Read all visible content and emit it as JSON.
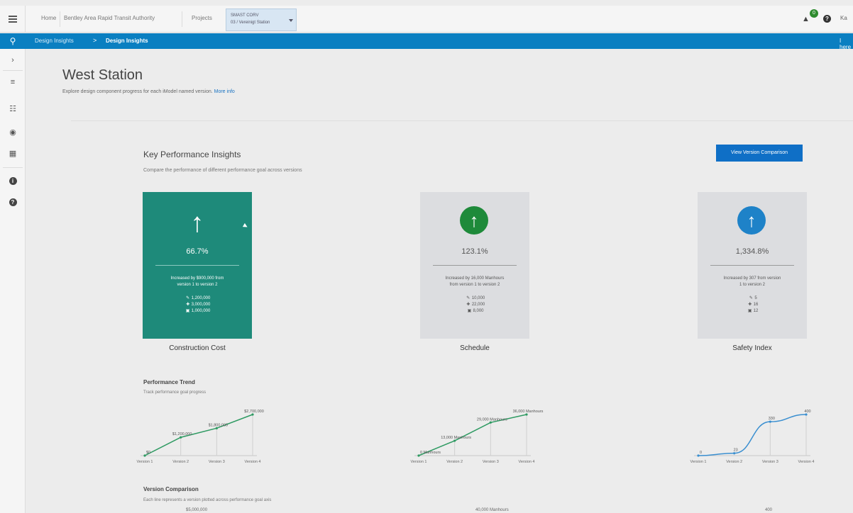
{
  "header": {
    "nav": [
      "Home",
      "Bentley Area Rapid Transit Authority",
      "Projects"
    ],
    "project_line1": "SMAST CORV",
    "project_line2": "03 / Vereinigt Station",
    "notifications": "0",
    "help_icon": "question-icon",
    "user": "Ka"
  },
  "breadcrumb": {
    "root": "Design Insights",
    "separator": ">",
    "current": "Design Insights",
    "right": "I here"
  },
  "page": {
    "title": "West Station",
    "description": "Explore design component progress for each iModel named version.",
    "more_info": "More info"
  },
  "kpi": {
    "title": "Key Performance Insights",
    "description": "Compare the performance of different performance goal across versions",
    "compare_button": "View Version Comparison",
    "cards": [
      {
        "label": "Construction Cost",
        "percent": "66.7%",
        "change_line1": "Increased by $900,000 from",
        "change_line2": "version 1 to version 2",
        "metrics": [
          "1,200,000",
          "3,000,000",
          "1,000,000"
        ],
        "icon": "arrow-up-icon",
        "color": "#1e8a7a"
      },
      {
        "label": "Schedule",
        "percent": "123.1%",
        "change_line1": "Increased by 16,000 Manhours",
        "change_line2": "from version 1 to version 2",
        "metrics": [
          "10,000",
          "22,000",
          "8,000"
        ],
        "icon": "arrow-up-circle-icon",
        "color": "#1e8a3a"
      },
      {
        "label": "Safety Index",
        "percent": "1,334.8%",
        "change_line1": "Increased by 307 from version",
        "change_line2": "1 to version 2",
        "metrics": [
          "5",
          "16",
          "12"
        ],
        "icon": "arrow-up-circle-icon",
        "color": "#1e82c8"
      }
    ]
  },
  "trend": {
    "title": "Performance Trend",
    "description": "Track performance goal progress",
    "x_labels": [
      "Version 1",
      "Version 2",
      "Version 3",
      "Version 4"
    ]
  },
  "comparison": {
    "title": "Version Comparison",
    "description": "Each line represents a version plotted across performance goal axis",
    "axis_tops": [
      "$5,000,000",
      "40,000 Manhours",
      "400"
    ]
  },
  "chart_data": [
    {
      "type": "line",
      "title": "",
      "x": [
        "Version 1",
        "Version 2",
        "Version 3",
        "Version 4"
      ],
      "values": [
        0,
        1200000,
        1800000,
        2700000
      ],
      "point_labels": [
        "$0",
        "$1,200,000",
        "$1,800,000",
        "$2,700,000"
      ],
      "ylim": [
        0,
        2700000
      ],
      "color": "#2e9a62"
    },
    {
      "type": "line",
      "title": "",
      "x": [
        "Version 1",
        "Version 2",
        "Version 3",
        "Version 4"
      ],
      "values": [
        0,
        13000,
        29000,
        36000
      ],
      "point_labels": [
        "0 Manhours",
        "13,000 Manhours",
        "29,000 Manhours",
        "36,000 Manhours"
      ],
      "ylim": [
        0,
        36000
      ],
      "color": "#2e9a62"
    },
    {
      "type": "line",
      "title": "",
      "x": [
        "Version 1",
        "Version 2",
        "Version 3",
        "Version 4"
      ],
      "values": [
        0,
        23,
        330,
        400
      ],
      "point_labels": [
        "0",
        "23",
        "330",
        "400"
      ],
      "ylim": [
        0,
        400
      ],
      "color": "#3a8fd0"
    }
  ]
}
